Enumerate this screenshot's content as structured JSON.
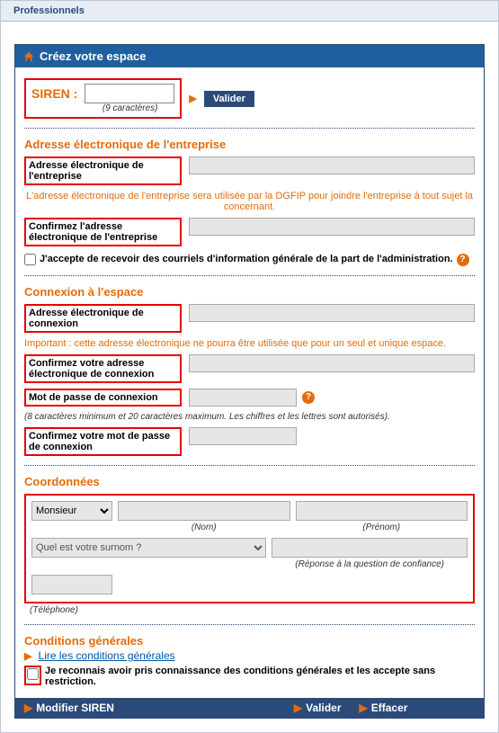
{
  "tab": {
    "label": "Professionnels"
  },
  "header": {
    "title": "Créez votre espace"
  },
  "siren": {
    "label": "SIREN :",
    "hint": "(9 caractères)",
    "validate": "Valider"
  },
  "section_email": {
    "title": "Adresse électronique de l'entreprise",
    "label_email": "Adresse électronique de l'entreprise",
    "info": "L'adresse électronique de l'entreprise sera utilisée par la DGFIP pour joindre l'entreprise à tout sujet la concernant.",
    "label_confirm": "Confirmez l'adresse électronique de l'entreprise",
    "checkbox_label": "J'accepte de recevoir des courriels d'information générale de la part de l'administration."
  },
  "section_connexion": {
    "title": "Connexion à l'espace",
    "label_email": "Adresse électronique de connexion",
    "important": "Important : cette adresse électronique ne pourra être utilisée que pour un seul et unique espace.",
    "label_confirm_email": "Confirmez votre adresse électronique de connexion",
    "label_pw": "Mot de passe de connexion",
    "pw_hint": "(8 caractères minimum et 20 caractères maximum. Les chiffres et les lettres sont autorisés).",
    "label_confirm_pw": "Confirmez votre mot de passe de connexion"
  },
  "section_coord": {
    "title": "Coordonnées",
    "civilite_options": [
      "Monsieur"
    ],
    "nom_label": "(Nom)",
    "prenom_label": "(Prénom)",
    "question_placeholder": "Quel est votre surnom ?",
    "reponse_label": "(Réponse à la question de confiance)",
    "telephone_label": "(Téléphone)"
  },
  "section_conditions": {
    "title": "Conditions générales",
    "link": "Lire les conditions générales",
    "checkbox_label": "Je reconnais avoir pris connaissance des conditions générales et les accepte sans restriction."
  },
  "footer": {
    "modify": "Modifier SIREN",
    "validate": "Valider",
    "clear": "Effacer"
  }
}
